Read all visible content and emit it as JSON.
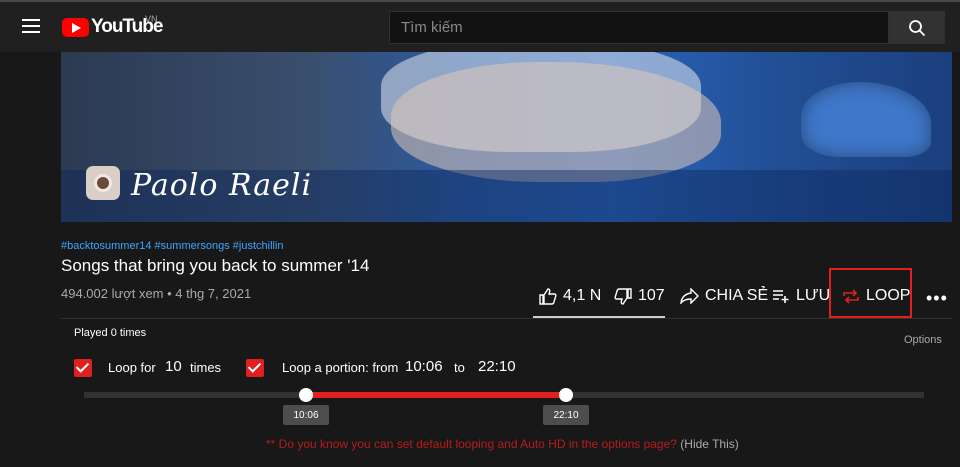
{
  "header": {
    "logo_text": "YouTube",
    "region_badge": "VN",
    "search_placeholder": "Tìm kiếm"
  },
  "video": {
    "channel_name": "Paolo Raeli",
    "hashtags": "#backtosummer14 #summersongs #justchillin",
    "title": "Songs that bring you back to summer '14",
    "meta": "494.002 lượt xem • 4 thg 7, 2021"
  },
  "actions": {
    "likes": "4,1 N",
    "dislikes": "107",
    "share": "CHIA SẺ",
    "save": "LƯU",
    "loop": "LOOP"
  },
  "looper": {
    "played": "Played 0 times",
    "options": "Options",
    "loop_for_label": "Loop for",
    "loop_count": "10",
    "times_label": "times",
    "portion_label": "Loop a portion: from",
    "from": "10:06",
    "to_label": "to",
    "to": "22:10",
    "tooltip_start": "10:06",
    "tooltip_end": "22:10",
    "notice": "** Do you know you can set default looping and Auto HD in the options page?",
    "hide": "(Hide This)"
  },
  "colors": {
    "accent_red": "#e0201f",
    "link_blue": "#3ea6ff",
    "background": "#181818"
  }
}
